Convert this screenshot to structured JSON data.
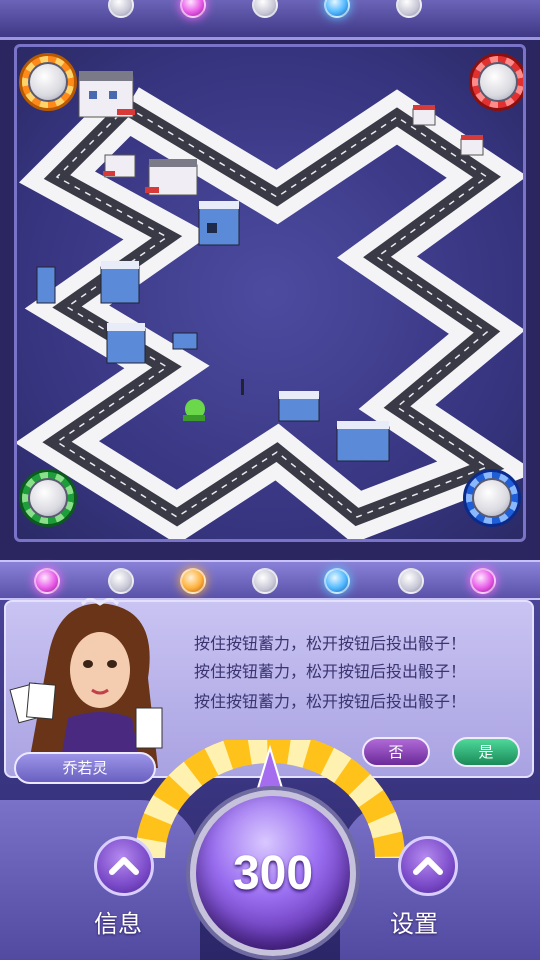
{
  "dialog": {
    "lines": [
      "按住按钮蓄力，松开按钮后投出骰子！",
      "按住按钮蓄力，松开按钮后投出骰子！",
      "按住按钮蓄力，松开按钮后投出骰子！"
    ],
    "no_label": "否",
    "yes_label": "是"
  },
  "player": {
    "name": "乔若灵"
  },
  "dice": {
    "power_value": "300"
  },
  "controls": {
    "info_label": "信息",
    "settings_label": "设置"
  },
  "tokens": [
    {
      "name": "orange-player-token",
      "color": "#ff8a1a"
    },
    {
      "name": "red-player-token",
      "color": "#e23030"
    },
    {
      "name": "green-player-token",
      "color": "#1e9e3a"
    },
    {
      "name": "blue-player-token",
      "color": "#1e5ed8"
    }
  ],
  "colors": {
    "board_bg": "#3f3d8c",
    "road": "#3a3a46",
    "tile": "#f4f4f6",
    "accent_purple": "#9a6ef0",
    "power_arc": "#ffc21a"
  }
}
